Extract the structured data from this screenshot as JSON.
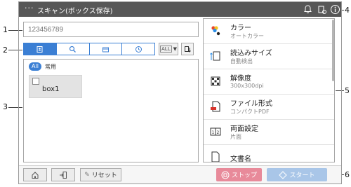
{
  "callouts": [
    "1",
    "2",
    "3",
    "4",
    "5",
    "6"
  ],
  "titlebar": {
    "menu_icon": "more-dots-icon",
    "title": "スキャン(ボックス保存)"
  },
  "destination_input": {
    "placeholder": "123456789"
  },
  "search_tabs": [
    {
      "icon": "user-box-icon",
      "active": true
    },
    {
      "icon": "search-icon",
      "active": false
    },
    {
      "icon": "group-icon",
      "active": false
    },
    {
      "icon": "history-clock-icon",
      "active": false
    }
  ],
  "index_select": {
    "label": "ALL"
  },
  "box_filter": {
    "all_label": "All",
    "common_label": "常用"
  },
  "boxes": [
    {
      "name": "box1"
    }
  ],
  "settings": [
    {
      "icon": "color-icon",
      "title": "カラー",
      "value": "オートカラー"
    },
    {
      "icon": "original-size-icon",
      "title": "読込みサイズ",
      "value": "自動検出"
    },
    {
      "icon": "resolution-icon",
      "title": "解像度",
      "value": "300x300dpi"
    },
    {
      "icon": "file-type-icon",
      "title": "ファイル形式",
      "value": "コンパクトPDF"
    },
    {
      "icon": "duplex-icon",
      "title": "両面設定",
      "value": "片面"
    },
    {
      "icon": "document-name-icon",
      "title": "文書名",
      "value": ""
    }
  ],
  "footer": {
    "reset_label": "リセット",
    "stop_label": "ストップ",
    "start_label": "スタート"
  },
  "colors": {
    "accent": "#3b7fd4",
    "titlebar": "#575757",
    "stop": "#e88a9a",
    "start": "#a9c6e8"
  }
}
